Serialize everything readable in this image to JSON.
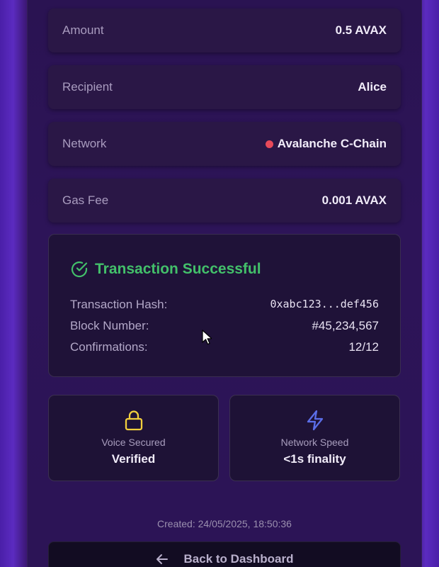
{
  "details": [
    {
      "label": "Amount",
      "value": "0.5 AVAX"
    },
    {
      "label": "Recipient",
      "value": "Alice"
    },
    {
      "label": "Network",
      "value": "Avalanche C-Chain",
      "dot_color": "#e84a5a"
    },
    {
      "label": "Gas Fee",
      "value": "0.001 AVAX"
    }
  ],
  "status": {
    "title": "Transaction Successful",
    "icon": "check-circle-icon",
    "color": "#43c06a",
    "hash_label": "Transaction Hash:",
    "hash_value": "0xabc123...def456",
    "block_label": "Block Number:",
    "block_value": "#45,234,567",
    "confirm_label": "Confirmations:",
    "confirm_value": "12/12"
  },
  "cards": [
    {
      "icon": "lock-icon",
      "caption": "Voice Secured",
      "value": "Verified"
    },
    {
      "icon": "lightning-icon",
      "caption": "Network Speed",
      "value": "<1s finality"
    }
  ],
  "created": "Created: 24/05/2025, 18:50:36",
  "back_button": {
    "label": "Back to Dashboard",
    "icon": "arrow-left-icon"
  }
}
